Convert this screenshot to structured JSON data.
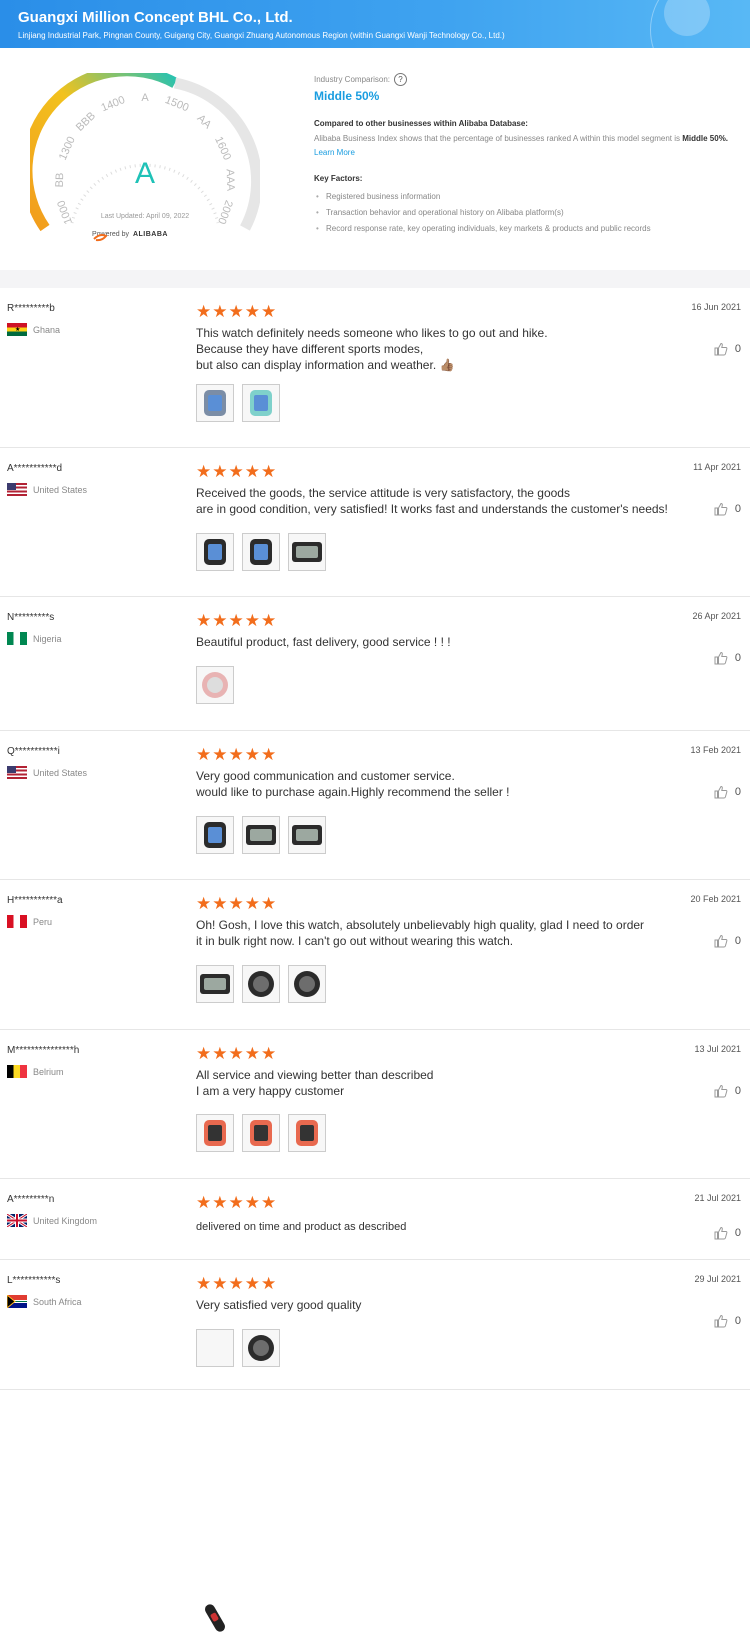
{
  "header": {
    "company": "Guangxi Million Concept BHL Co., Ltd.",
    "address": "Linjiang Industrial Park, Pingnan County, Guigang City, Guangxi Zhuang Autonomous Region (within Guangxi Wanji Technology Co., Ltd.)"
  },
  "gauge": {
    "grade": "A",
    "last_updated": "Last Updated: April 09, 2022",
    "powered_by": "Powered by",
    "brand": "ALIBABA",
    "labels": [
      "1000",
      "BB",
      "1300",
      "BBB",
      "1400",
      "A",
      "1500",
      "AA",
      "1600",
      "AAA",
      "2000"
    ],
    "colors": {
      "start": "#f29b1d",
      "end": "#1fc2b7",
      "track": "#e6e6e6"
    }
  },
  "comparison": {
    "label": "Industry Comparison:",
    "help_icon": "?",
    "value": "Middle 50%",
    "heading": "Compared to other businesses within Alibaba Database:",
    "desc": "Alibaba Business Index shows that the percentage of businesses ranked A within this model segment is",
    "desc_bold": "Middle 50%.",
    "learn_more": "Learn More",
    "key_factors_title": "Key Factors:",
    "key_factors": [
      "Registered business information",
      "Transaction behavior and operational history on Alibaba platform(s)",
      "Record response rate, key operating individuals, key markets & products and public records"
    ]
  },
  "reviews": [
    {
      "user": "R*********b",
      "country": "Ghana",
      "flag": "ghana",
      "stars": "★★★★★",
      "date": "16 Jun 2021",
      "likes": "0",
      "lines": [
        "This watch definitely needs someone who likes to go out and hike.",
        "Because they have different sports modes,",
        "but also can display information and weather. 👍🏽"
      ],
      "thumbs": [
        "blue",
        "teal"
      ]
    },
    {
      "user": "A***********d",
      "country": "United States",
      "flag": "us",
      "stars": "★★★★★",
      "date": "11 Apr 2021",
      "likes": "0",
      "lines": [
        "Received the goods, the service attitude is very satisfactory, the goods",
        "are in good condition, very satisfied! It works fast and understands the customer's needs!"
      ],
      "thumbs": [
        "dark",
        "dark",
        "wide"
      ]
    },
    {
      "user": "N*********s",
      "country": "Nigeria",
      "flag": "nigeria",
      "stars": "★★★★★",
      "date": "26 Apr 2021",
      "likes": "0",
      "lines": [
        "Beautiful product, fast delivery, good service ! ! !"
      ],
      "thumbs": [
        "pink"
      ]
    },
    {
      "user": "Q***********i",
      "country": "United States",
      "flag": "us",
      "stars": "★★★★★",
      "date": "13 Feb 2021",
      "likes": "0",
      "lines": [
        "Very good communication and customer service.",
        "would like to purchase again.Highly recommend the seller !"
      ],
      "thumbs": [
        "dark",
        "wide",
        "wide"
      ]
    },
    {
      "user": "H***********a",
      "country": "Peru",
      "flag": "peru",
      "stars": "★★★★★",
      "date": "20 Feb 2021",
      "likes": "0",
      "lines": [
        "Oh! Gosh, I love this watch, absolutely unbelievably high quality, glad I need to order",
        "it in bulk right now. I can't go out without wearing this watch."
      ],
      "thumbs": [
        "wide",
        "round",
        "round"
      ]
    },
    {
      "user": "M***************h",
      "country": "Belrium",
      "flag": "belgium",
      "stars": "★★★★★",
      "date": "13 Jul 2021",
      "likes": "0",
      "lines": [
        "All service and viewing better than described",
        "I am a very happy customer"
      ],
      "thumbs": [
        "red",
        "red",
        "red"
      ]
    },
    {
      "user": "A*********n",
      "country": "United Kingdom",
      "flag": "uk",
      "stars": "★★★★★",
      "date": "21 Jul 2021",
      "likes": "0",
      "lines": [
        "delivered on time and product as described"
      ],
      "thumbs": []
    },
    {
      "user": "L***********s",
      "country": "South Africa",
      "flag": "southafrica",
      "stars": "★★★★★",
      "date": "29 Jul 2021",
      "likes": "0",
      "lines": [
        "Very satisfied very good quality"
      ],
      "thumbs": [
        "band",
        "round"
      ]
    }
  ]
}
